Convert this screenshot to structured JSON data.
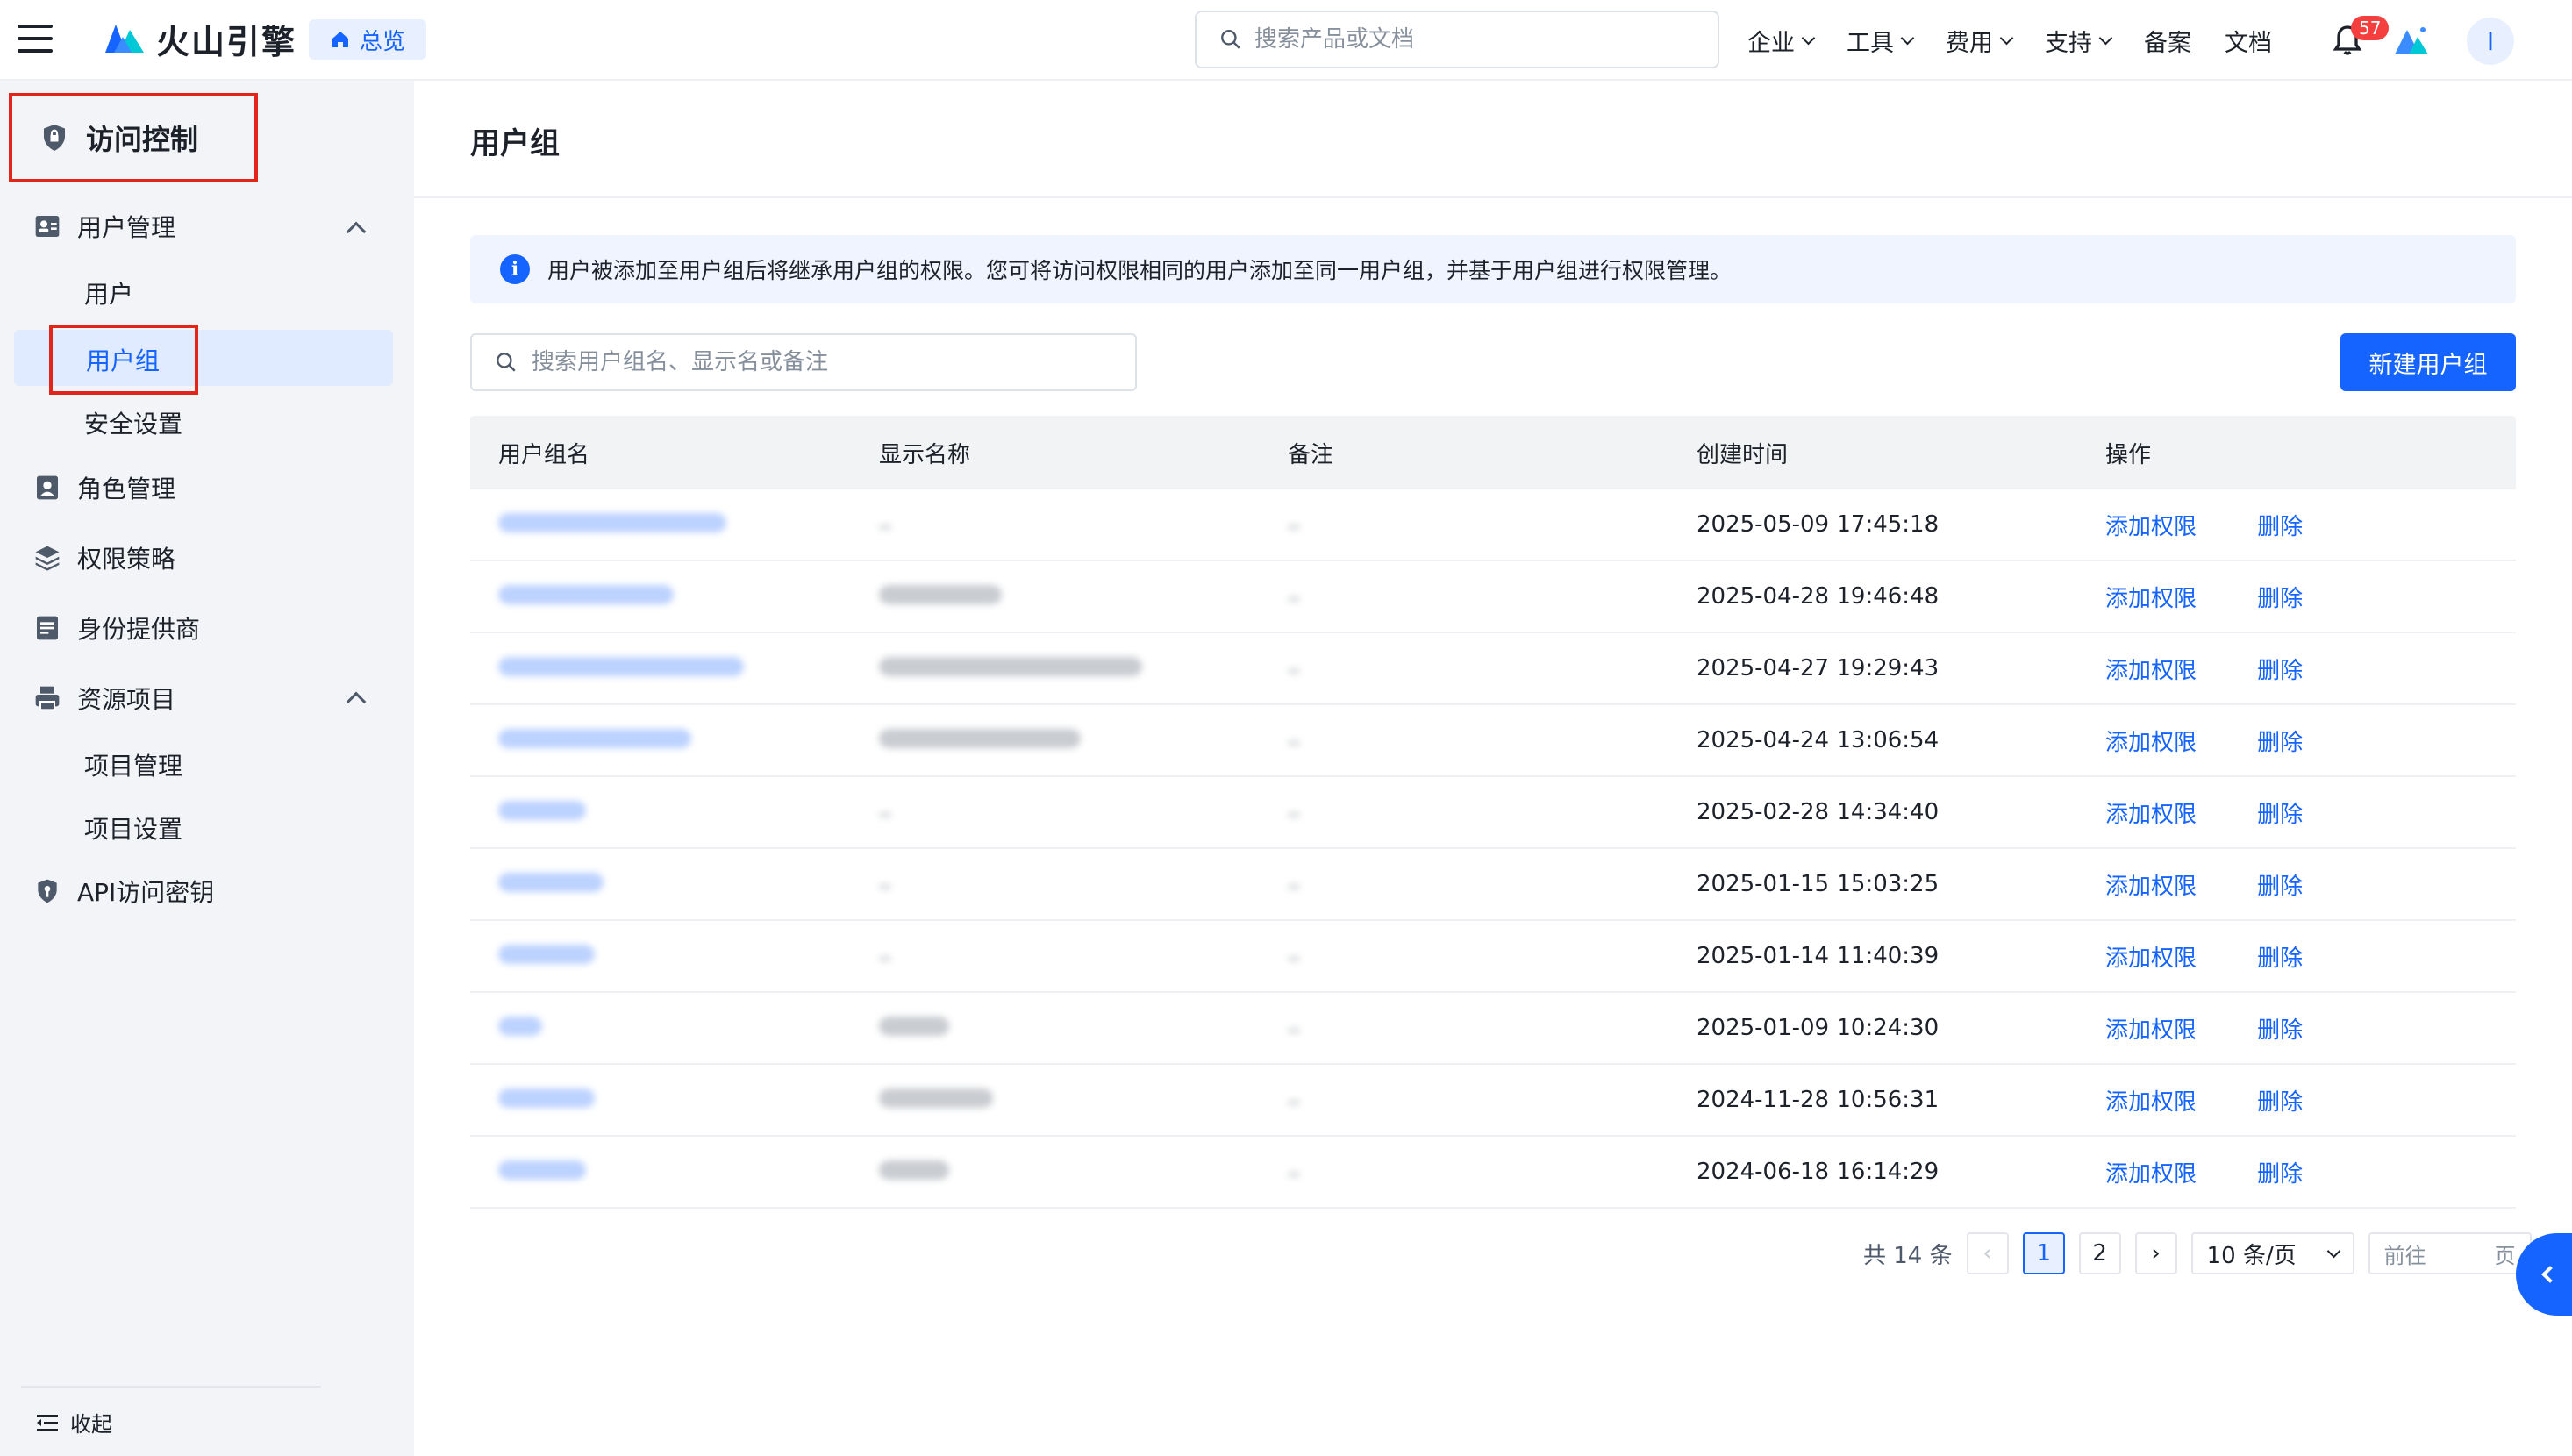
{
  "topbar": {
    "brand": "火山引擎",
    "home_chip": "总览",
    "search_placeholder": "搜索产品或文档",
    "nav": [
      "企业",
      "工具",
      "费用",
      "支持",
      "备案",
      "文档"
    ],
    "notification_count": "57",
    "avatar_initial": "I"
  },
  "sidebar": {
    "title": "访问控制",
    "user_mgmt": "用户管理",
    "user": "用户",
    "user_group": "用户组",
    "security": "安全设置",
    "role_mgmt": "角色管理",
    "policy": "权限策略",
    "idp": "身份提供商",
    "resources": "资源项目",
    "project_mgmt": "项目管理",
    "project_settings": "项目设置",
    "api_keys": "API访问密钥",
    "collapse": "收起"
  },
  "main": {
    "title": "用户组",
    "info": "用户被添加至用户组后将继承用户组的权限。您可将访问权限相同的用户添加至同一用户组，并基于用户组进行权限管理。",
    "search_placeholder": "搜索用户组名、显示名或备注",
    "new_button": "新建用户组",
    "columns": [
      "用户组名",
      "显示名称",
      "备注",
      "创建时间",
      "操作"
    ],
    "rows": [
      {
        "created": "2025-05-09 17:45:18"
      },
      {
        "created": "2025-04-28 19:46:48"
      },
      {
        "created": "2025-04-27 19:29:43"
      },
      {
        "created": "2025-04-24 13:06:54"
      },
      {
        "created": "2025-02-28 14:34:40"
      },
      {
        "created": "2025-01-15 15:03:25"
      },
      {
        "created": "2025-01-14 11:40:39"
      },
      {
        "created": "2025-01-09 10:24:30"
      },
      {
        "created": "2024-11-28 10:56:31"
      },
      {
        "created": "2024-06-18 16:14:29"
      }
    ],
    "op_add": "添加权限",
    "op_delete": "删除",
    "pagination": {
      "total": "共 14 条",
      "page1": "1",
      "page2": "2",
      "page_size": "10 条/页",
      "goto": "前往",
      "page_unit": "页"
    }
  },
  "colors": {
    "accent": "#1664ff",
    "highlight": "#e1251b",
    "sidebar_bg": "#f2f4f8"
  }
}
